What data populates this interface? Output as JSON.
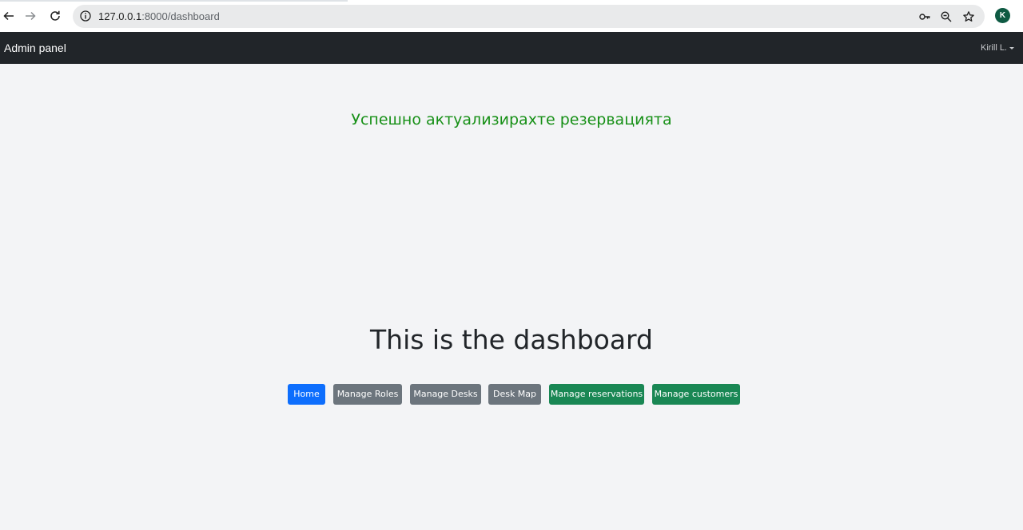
{
  "browser": {
    "url_host": "127.0.0.1",
    "url_path": ":8000/dashboard",
    "profile_initial": "K",
    "icons": [
      "back-arrow-icon",
      "forward-arrow-icon",
      "reload-icon",
      "info-icon",
      "password-key-icon",
      "zoom-icon",
      "star-icon"
    ]
  },
  "navbar": {
    "brand": "Admin panel",
    "user": "Kirill L."
  },
  "main": {
    "alert": "Успешно актуализирахте резервацията",
    "title": "This is the dashboard",
    "buttons": {
      "home": "Home",
      "manage_roles": "Manage Roles",
      "manage_desks": "Manage Desks",
      "desk_map": "Desk Map",
      "manage_reservations": "Manage reservations",
      "manage_customers": "Manage customers"
    }
  },
  "colors": {
    "navbar_bg": "#212529",
    "page_bg": "#f3f4f6",
    "alert_text": "#179017",
    "primary": "#0d6efd",
    "secondary": "#6c757d",
    "success": "#198754"
  }
}
